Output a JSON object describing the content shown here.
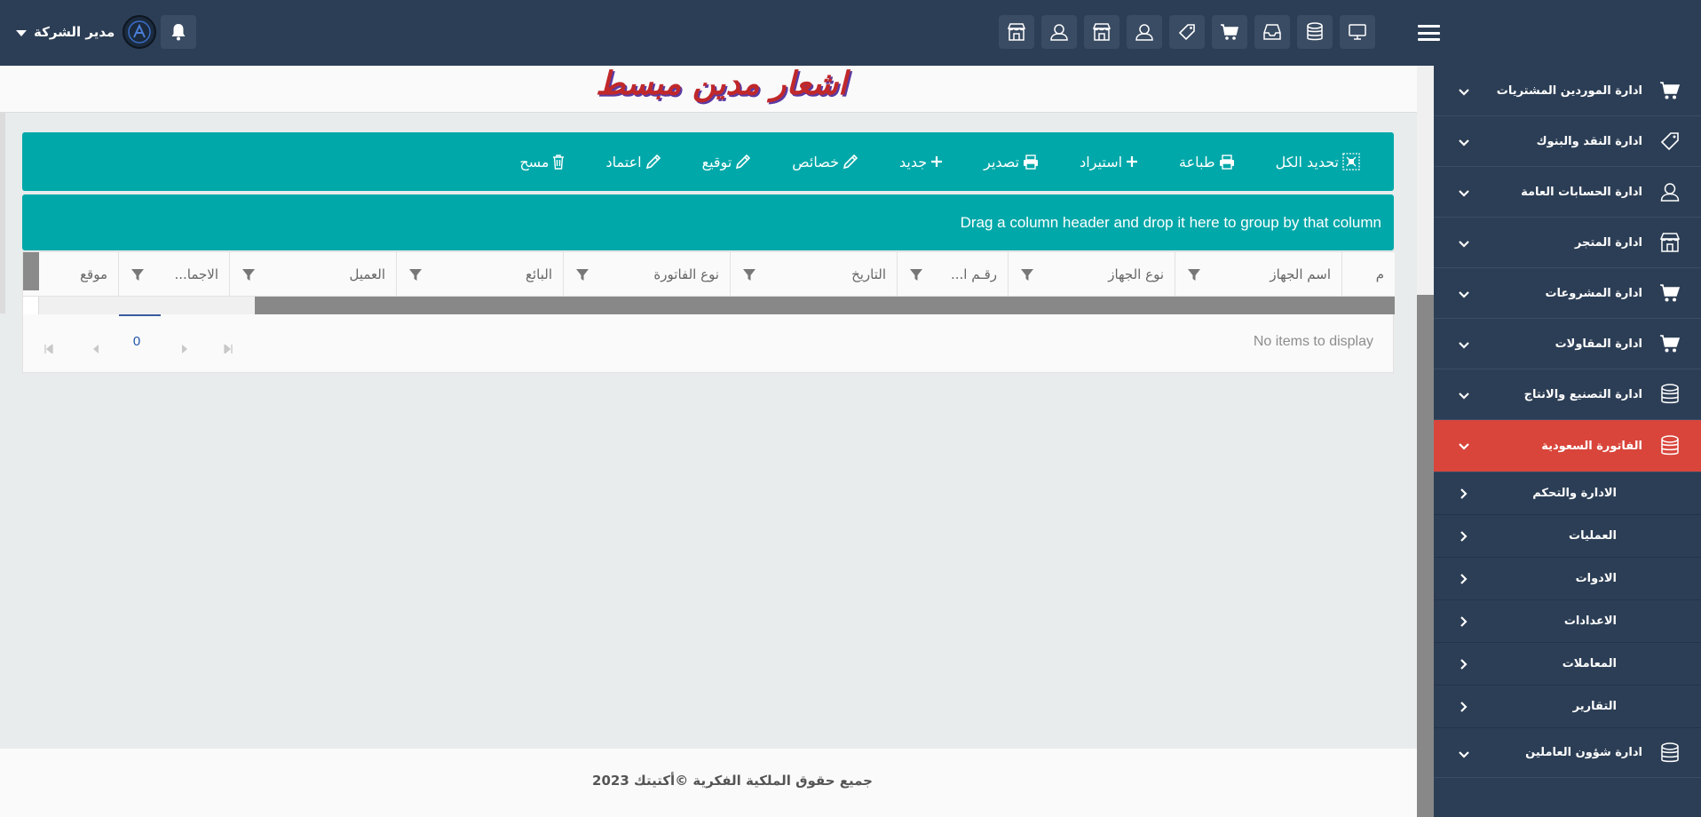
{
  "header": {
    "user_name": "مدير الشركة"
  },
  "page": {
    "title": "اشعار مدين مبسط"
  },
  "toolbar": {
    "buttons": [
      {
        "label": "تحديد الكل",
        "icon": "select-all-icon"
      },
      {
        "label": "طباعة",
        "icon": "print-icon"
      },
      {
        "label": "استيراد",
        "icon": "plus-icon"
      },
      {
        "label": "تصدير",
        "icon": "print-icon"
      },
      {
        "label": "جديد",
        "icon": "plus-icon"
      },
      {
        "label": "خصائص",
        "icon": "pencil-icon"
      },
      {
        "label": "توقيع",
        "icon": "pencil-icon"
      },
      {
        "label": "اعتماد",
        "icon": "pencil-icon"
      },
      {
        "label": "مسح",
        "icon": "trash-icon"
      }
    ]
  },
  "grid": {
    "group_panel_text": "Drag a column header and drop it here to group by that column",
    "columns": [
      "م",
      "اسم الجهاز",
      "نوع الجهاز",
      "رقـم ا...",
      "التاريخ",
      "نوع الفاتورة",
      "البائع",
      "العميل",
      "الاجما...",
      "موقع"
    ],
    "empty_text": "No items to display",
    "page_number": "0"
  },
  "sidebar": {
    "items": [
      {
        "label": "ادارة الموردين المشتريات",
        "icon": "cart-icon"
      },
      {
        "label": "ادارة النقد والبنوك",
        "icon": "tag-icon"
      },
      {
        "label": "ادارة الحسابات العامة",
        "icon": "user-icon"
      },
      {
        "label": "ادارة المتجر",
        "icon": "store-icon"
      },
      {
        "label": "ادارة المشروعات",
        "icon": "cart-icon"
      },
      {
        "label": "ادارة المقاولات",
        "icon": "cart-icon"
      },
      {
        "label": "ادارة التصنيع والانتاج",
        "icon": "database-icon"
      },
      {
        "label": "الفاتورة السعودية",
        "icon": "database-icon",
        "active": true
      }
    ],
    "sub_items": [
      "الادارة والتحكم",
      "العمليات",
      "الادوات",
      "الاعدادات",
      "المعاملات",
      "التقارير"
    ],
    "bottom_item": {
      "label": "ادارة شؤون العاملين",
      "icon": "database-icon"
    }
  },
  "footer": {
    "text": "جميع حقوق الملكية الفكرية ©أكتيتك 2023"
  },
  "colors": {
    "topbar": "#2c3e55",
    "accent": "#00a8a9",
    "active": "#d9453b"
  }
}
